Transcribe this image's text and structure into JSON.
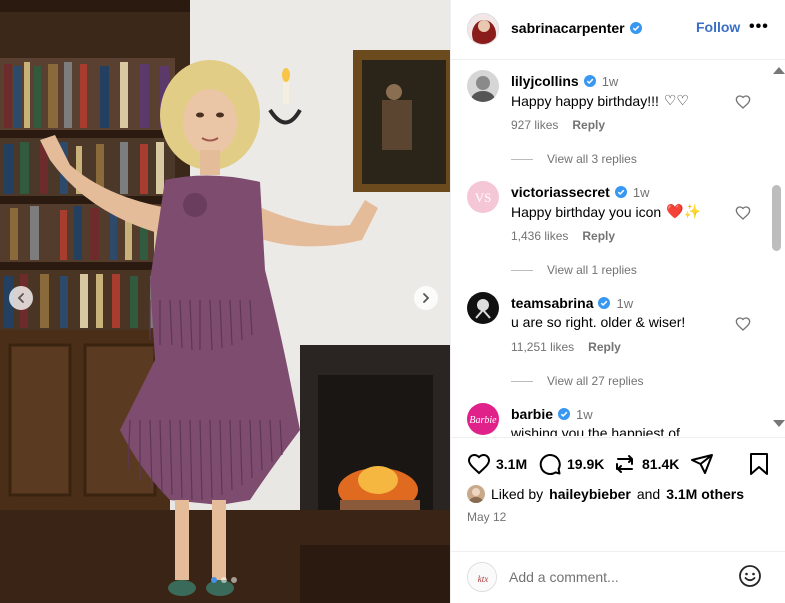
{
  "post": {
    "username": "sabrinacarpenter",
    "follow_label": "Follow",
    "more_label": "•••"
  },
  "comments": [
    {
      "username": "lilyjcollins",
      "time": "1w",
      "text": "Happy happy birthday!!!",
      "emoji": "♡♡",
      "likes": "927 likes",
      "reply_label": "Reply",
      "view_replies": "View all 3 replies"
    },
    {
      "username": "victoriassecret",
      "time": "1w",
      "text": "Happy birthday you icon",
      "emoji": "❤️✨",
      "likes": "1,436 likes",
      "reply_label": "Reply",
      "view_replies": "View all 1 replies"
    },
    {
      "username": "teamsabrina",
      "time": "1w",
      "text": "u are so right. older & wiser!",
      "emoji": "",
      "likes": "11,251 likes",
      "reply_label": "Reply",
      "view_replies": "View all 27 replies"
    },
    {
      "username": "barbie",
      "time": "1w",
      "text": "wishing you the happiest of",
      "emoji": "",
      "likes": "",
      "reply_label": "",
      "view_replies": ""
    }
  ],
  "actions": {
    "like_count": "3.1M",
    "comment_count": "19.9K",
    "repost_count": "81.4K"
  },
  "liked_by": {
    "prefix": "Liked by",
    "user": "haileybieber",
    "middle": "and",
    "others": "3.1M others"
  },
  "date": "May 12",
  "add_comment": {
    "placeholder": "Add a comment..."
  },
  "carousel": {
    "slide_count": 3,
    "active_index": 0
  },
  "icons": {
    "verified": "verified-badge-icon",
    "heart": "heart-icon",
    "comment": "comment-icon",
    "repost": "repost-icon",
    "share": "share-icon",
    "save": "bookmark-icon",
    "emoji": "emoji-icon"
  },
  "colors": {
    "follow": "#3a6fc7",
    "verified": "#3897f0",
    "muted_text": "#737373",
    "border": "#efefef"
  }
}
